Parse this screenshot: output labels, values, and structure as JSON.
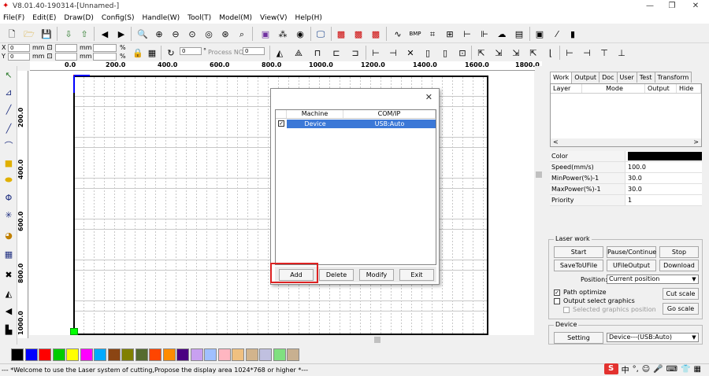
{
  "window": {
    "title": "V8.01.40-190314-[Unnamed-]",
    "minimize": "—",
    "restore": "❐",
    "close": "✕"
  },
  "menu": [
    "File(F)",
    "Edit(E)",
    "Draw(D)",
    "Config(S)",
    "Handle(W)",
    "Tool(T)",
    "Model(M)",
    "View(V)",
    "Help(H)"
  ],
  "coords": {
    "x_label": "X",
    "y_label": "Y",
    "x_value": "0",
    "y_value": "0",
    "unit_mm": "mm",
    "unit_pct": "%",
    "angle": "0",
    "angle_unit": "°",
    "process_label": "Process NO:",
    "process_value": "0"
  },
  "ruler": {
    "top": [
      "0.0",
      "200.0",
      "400.0",
      "600.0",
      "800.0",
      "1000.0",
      "1200.0",
      "1400.0",
      "1600.0",
      "1800.0"
    ],
    "left": [
      "200.0",
      "400.0",
      "600.0",
      "800.0",
      "1000.0"
    ]
  },
  "right_panel": {
    "tabs": [
      "Work",
      "Output",
      "Doc",
      "User",
      "Test",
      "Transform"
    ],
    "layer_headers": [
      "Layer",
      "Mode",
      "Output",
      "Hide"
    ],
    "scroll_left": "<",
    "scroll_right": ">",
    "properties": [
      {
        "key": "Color",
        "value": ""
      },
      {
        "key": "Speed(mm/s)",
        "value": "100.0"
      },
      {
        "key": "MinPower(%)-1",
        "value": "30.0"
      },
      {
        "key": "MaxPower(%)-1",
        "value": "30.0"
      },
      {
        "key": "Priority",
        "value": "1"
      }
    ],
    "laser_work": {
      "title": "Laser work",
      "start": "Start",
      "pause": "Pause/Continue",
      "stop": "Stop",
      "save_to_ufile": "SaveToUFile",
      "ufile_output": "UFileOutput",
      "download": "Download",
      "position_label": "Position:",
      "position_value": "Current position",
      "path_optimize": "Path optimize",
      "output_selected": "Output select graphics",
      "selected_position": "Selected graphics position",
      "cut_scale": "Cut scale",
      "go_scale": "Go scale"
    },
    "device": {
      "title": "Device",
      "setting": "Setting",
      "value": "Device---(USB:Auto)"
    }
  },
  "dialog": {
    "close": "✕",
    "headers": [
      "Machine",
      "COM/IP"
    ],
    "rows": [
      {
        "checked": "✓",
        "machine": "Device",
        "com": "USB:Auto"
      }
    ],
    "buttons": [
      "Add",
      "Delete",
      "Modify",
      "Exit"
    ]
  },
  "palette": [
    "#000000",
    "#0000ff",
    "#ff0000",
    "#00cc00",
    "#ffff00",
    "#ff00ff",
    "#00aaff",
    "#8b4513",
    "#808000",
    "#556b2f",
    "#ff4500",
    "#ff8c00",
    "#4b0082",
    "#c8a0f0",
    "#a0c0ff",
    "#ffb6c1",
    "#f0c080",
    "#d2b48c",
    "#c0c0e0",
    "#80e080",
    "#c8b090"
  ],
  "status": "--- *Welcome to use the Laser system of cutting,Propose the display area 1024*768 or higher *---",
  "tray": {
    "logo": "S",
    "ime": "中",
    "punct": "°,",
    "emoji": "☺",
    "mic": "🎤",
    "keyboard": "⌨",
    "shirt": "👕",
    "grid": "▦"
  },
  "colors": {
    "selection": "#3b78d7",
    "highlight": "#d22222",
    "origin_axis": "#0000ff",
    "origin_marker": "#00ff00"
  }
}
